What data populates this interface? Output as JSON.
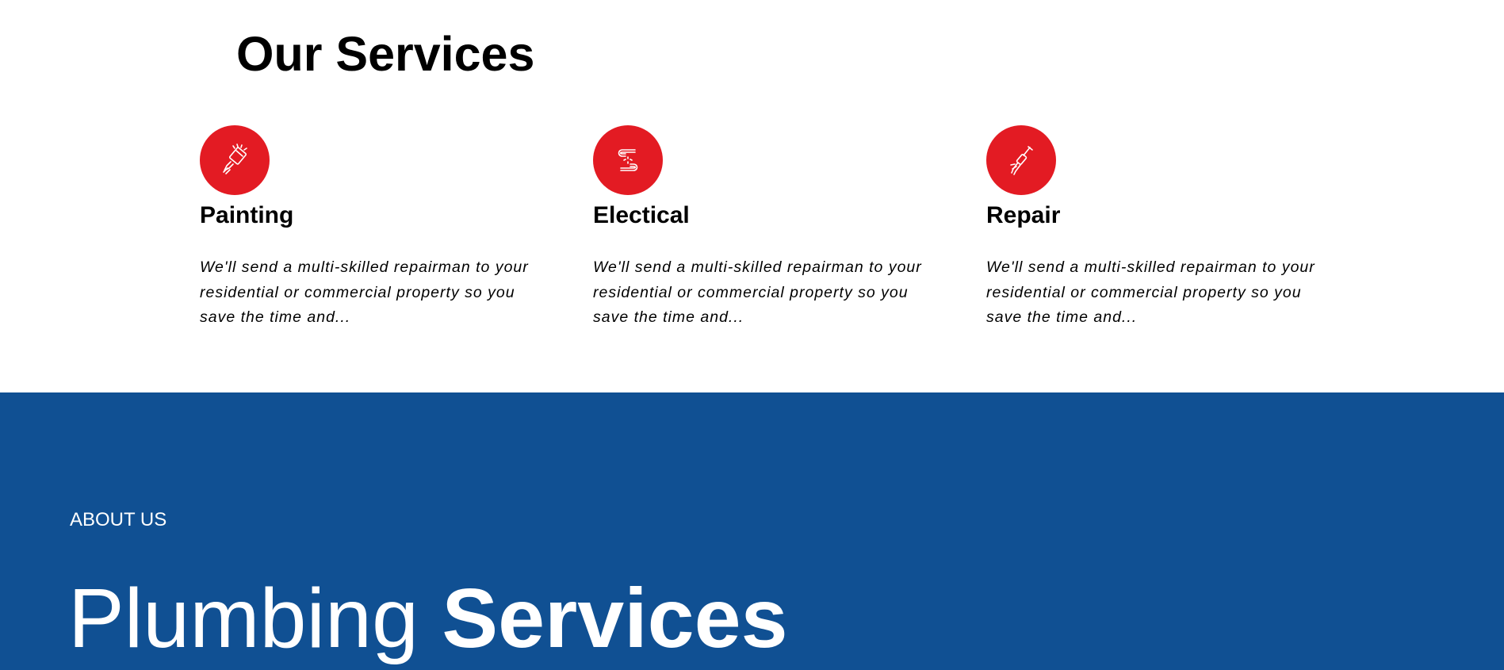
{
  "services": {
    "title": "Our Services",
    "items": [
      {
        "icon": "paint-brush-icon",
        "title": "Painting",
        "text": "We'll send a multi-skilled repairman to your residential or commercial property so you save the time and..."
      },
      {
        "icon": "cable-icon",
        "title": "Electical",
        "text": "We'll send a multi-skilled repairman to your residential or commercial property so you save the time and..."
      },
      {
        "icon": "screwdriver-icon",
        "title": "Repair",
        "text": "We'll send a multi-skilled repairman to your residential or commercial property so you save the time and..."
      }
    ]
  },
  "about": {
    "eyebrow": "ABOUT US",
    "heading_light": "Plumbing",
    "heading_bold": "Services"
  },
  "colors": {
    "accent_red": "#e31b23",
    "brand_blue": "#105093",
    "text": "#000000",
    "on_dark": "#ffffff"
  }
}
